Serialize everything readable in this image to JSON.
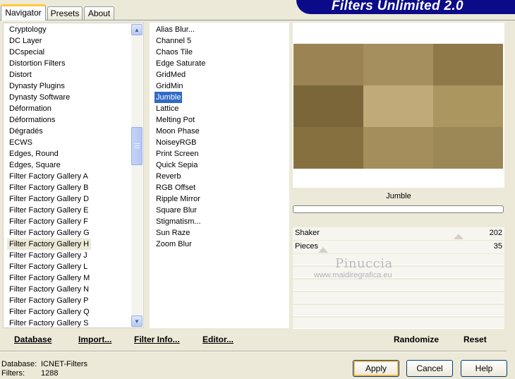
{
  "tabs": [
    {
      "label": "Navigator",
      "active": true
    },
    {
      "label": "Presets",
      "active": false
    },
    {
      "label": "About",
      "active": false
    }
  ],
  "banner": {
    "title": "Filters Unlimited 2.0"
  },
  "categories": {
    "items": [
      "Cryptology",
      "DC Layer",
      "DCspecial",
      "Distortion Filters",
      "Distort",
      "Dynasty Plugins",
      "Dynasty Software",
      "Déformation",
      "Déformations",
      "Dégradés",
      "ECWS",
      "Edges, Round",
      "Edges, Square",
      "Filter Factory Gallery A",
      "Filter Factory Gallery B",
      "Filter Factory Gallery D",
      "Filter Factory Gallery E",
      "Filter Factory Gallery F",
      "Filter Factory Gallery G",
      "Filter Factory Gallery H",
      "Filter Factory Gallery J",
      "Filter Factory Gallery L",
      "Filter Factory Gallery M",
      "Filter Factory Gallery N",
      "Filter Factory Gallery P",
      "Filter Factory Gallery Q",
      "Filter Factory Gallery S"
    ],
    "selected": "Filter Factory Gallery H"
  },
  "filters": {
    "items": [
      "Alias Blur...",
      "Channel 5",
      "Chaos Tile",
      "Edge Saturate",
      "GridMed",
      "GridMin",
      "Jumble",
      "Lattice",
      "Melting Pot",
      "Moon Phase",
      "NoiseyRGB",
      "Print Screen",
      "Quick Sepia",
      "Reverb",
      "RGB Offset",
      "Ripple Mirror",
      "Square Blur",
      "Stigmatism...",
      "Sun Raze",
      "Zoom Blur"
    ],
    "selected": "Jumble"
  },
  "preview": {
    "filter_name": "Jumble",
    "tiles": [
      "#9b8354",
      "#a58f5e",
      "#8f7949",
      "#7a6638",
      "#c0aa7a",
      "#ab965f",
      "#86703f",
      "#a38e5c",
      "#9c8757"
    ]
  },
  "params": [
    {
      "label": "Shaker",
      "value": "202"
    },
    {
      "label": "Pieces",
      "value": "35"
    }
  ],
  "watermark": {
    "name": "Pinuccia",
    "url": "www.maidiregrafica.eu"
  },
  "toolbar": {
    "database": "Database",
    "import": "Import...",
    "filter_info": "Filter Info...",
    "editor": "Editor...",
    "randomize": "Randomize",
    "reset": "Reset"
  },
  "status": {
    "database_label": "Database:",
    "database_value": "ICNET-Filters",
    "filters_label": "Filters:",
    "filters_value": "1288"
  },
  "buttons": {
    "apply": "Apply",
    "cancel": "Cancel",
    "help": "Help"
  }
}
